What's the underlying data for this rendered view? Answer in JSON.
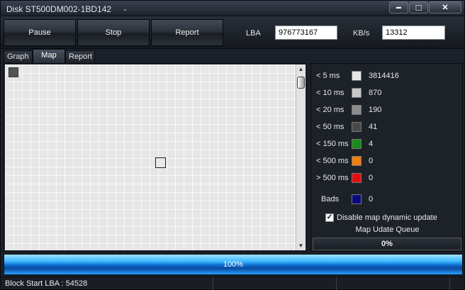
{
  "window": {
    "title": "Disk ST500DM002-1BD142",
    "title_suffix": "-"
  },
  "window_controls": {
    "minimize": "▬",
    "maximize": "□",
    "close": "✕"
  },
  "toolbar": {
    "pause_label": "Pause",
    "stop_label": "Stop",
    "report_label": "Report",
    "lba_label": "LBA",
    "lba_value": "976773167",
    "kbs_label": "KB/s",
    "kbs_value": "13312"
  },
  "tabs": [
    {
      "label": "Graph",
      "active": false
    },
    {
      "label": "Map",
      "active": true
    },
    {
      "label": "Report",
      "active": false
    }
  ],
  "legend": {
    "rows": [
      {
        "label": "< 5 ms",
        "color": "#e6e6e6",
        "count": "3814416"
      },
      {
        "label": "< 10 ms",
        "color": "#c8c8c8",
        "count": "870"
      },
      {
        "label": "< 20 ms",
        "color": "#8c8c8c",
        "count": "190"
      },
      {
        "label": "< 50 ms",
        "color": "#4a4a4a",
        "count": "41"
      },
      {
        "label": "< 150 ms",
        "color": "#1a8a1a",
        "count": "4"
      },
      {
        "label": "< 500 ms",
        "color": "#f08010",
        "count": "0"
      },
      {
        "label": "> 500 ms",
        "color": "#e01010",
        "count": "0"
      }
    ],
    "bads": {
      "label": "Bads",
      "color": "#0a0a80",
      "count": "0"
    },
    "disable_map_label": "Disable map dynamic update",
    "disable_map_checked": true,
    "queue_label": "Map Udate Queue",
    "queue_value": "0%"
  },
  "progress": {
    "text": "100%",
    "fraction": 1.0
  },
  "status": {
    "block_start": "Block Start LBA : 54528"
  }
}
